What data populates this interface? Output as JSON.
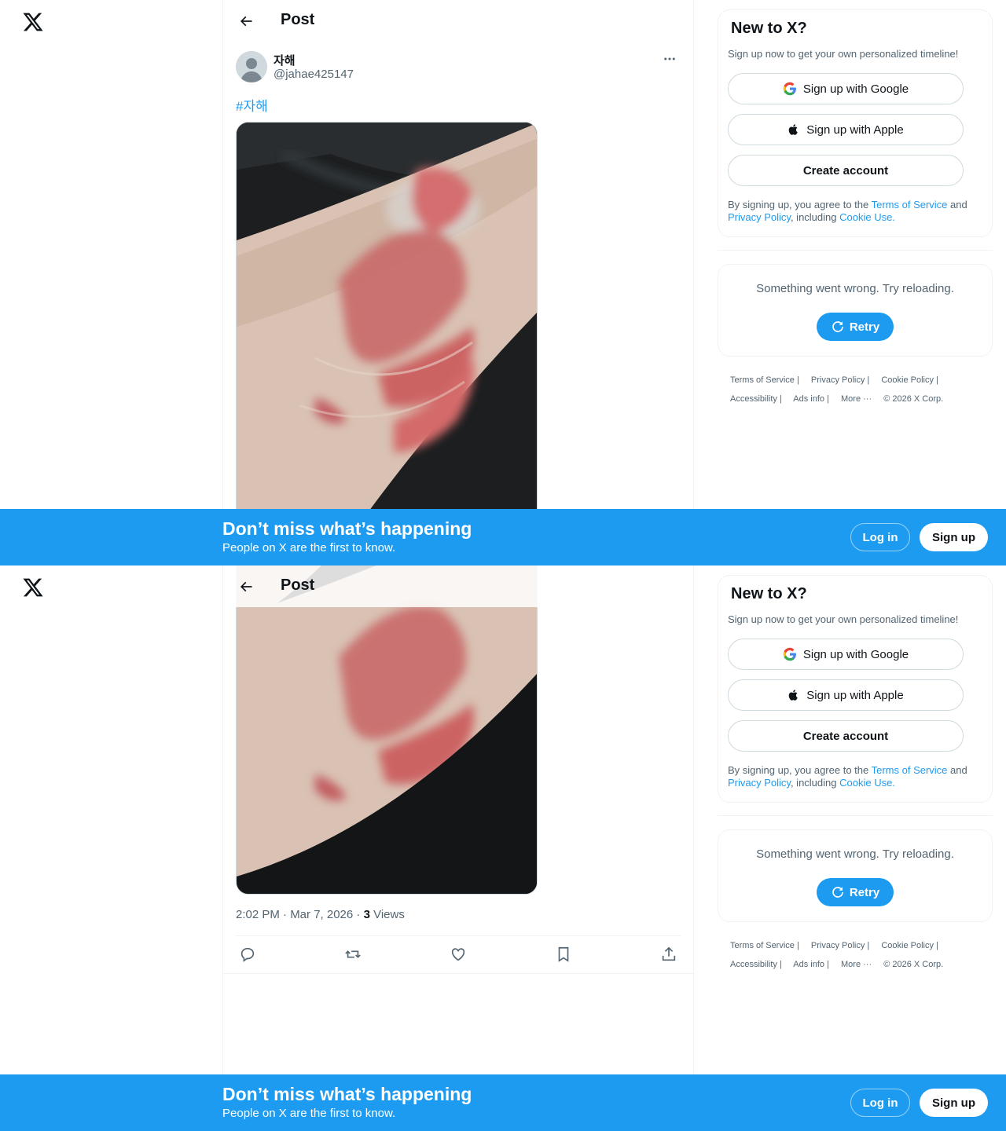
{
  "header": {
    "title": "Post"
  },
  "post": {
    "display_name": "자해",
    "handle": "@jahae425147",
    "hashtag": "#자해",
    "time": "2:02 PM · Mar 7, 2026 · ",
    "views_count": "3",
    "views_label": " Views"
  },
  "actions": [
    "reply",
    "repost",
    "like",
    "bookmark",
    "share"
  ],
  "sidebar": {
    "signup": {
      "title": "New to X?",
      "subtitle": "Sign up now to get your own personalized timeline!",
      "google_label": "Sign up with Google",
      "apple_label": "Sign up with Apple",
      "create_label": "Create account",
      "legal_prefix": "By signing up, you agree to the ",
      "terms_link": "Terms of Service",
      "legal_and": " and ",
      "privacy_link": "Privacy Policy",
      "legal_including": ", including ",
      "cookie_link": "Cookie Use."
    },
    "error": {
      "message": "Something went wrong. Try reloading.",
      "retry_label": "Retry"
    },
    "footer": {
      "terms": "Terms of Service",
      "privacy": "Privacy Policy",
      "cookie": "Cookie Policy",
      "accessibility": "Accessibility",
      "ads": "Ads info",
      "more": "More ···",
      "copyright": "© 2026 X Corp."
    }
  },
  "banner": {
    "title": "Don’t miss what’s happening",
    "subtitle": "People on X are the first to know.",
    "login_label": "Log in",
    "signup_label": "Sign up"
  },
  "colors": {
    "accent": "#1d9bf0",
    "text": "#0f1419",
    "muted": "#536471",
    "border": "#eff3f4"
  }
}
